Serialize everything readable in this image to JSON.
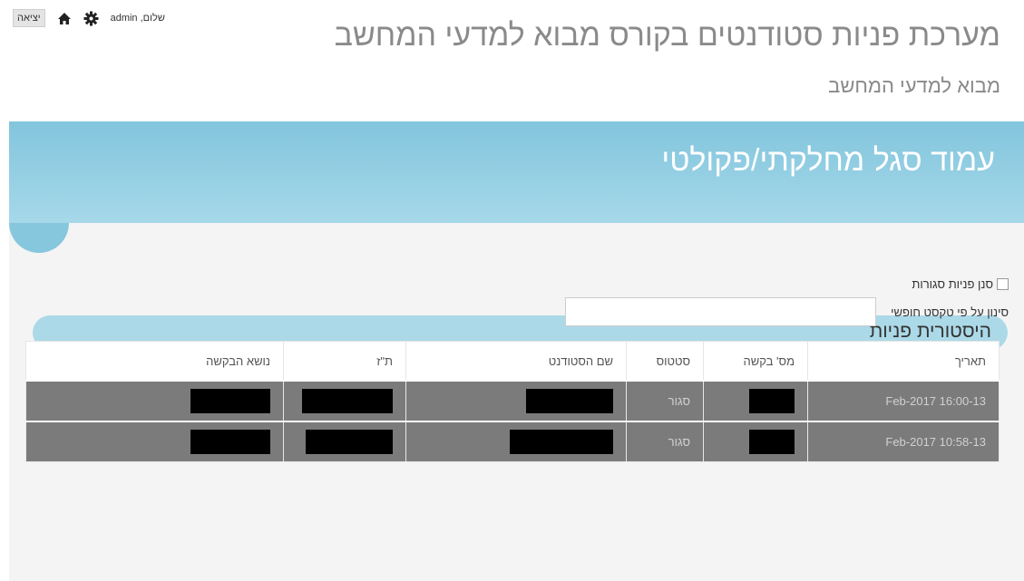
{
  "topbar": {
    "logout_label": "יציאה",
    "home_icon": "home-icon",
    "settings_icon": "gear-icon",
    "greeting": "שלום, admin"
  },
  "header": {
    "title": "מערכת פניות סטודנטים בקורס מבוא למדעי המחשב",
    "subtitle": "מבוא למדעי המחשב"
  },
  "banner": {
    "title": "עמוד סגל מחלקתי/פקולטי"
  },
  "section": {
    "title": "היסטורית פניות"
  },
  "filters": {
    "closed_label": "סנן פניות סגורות",
    "freetext_label": "סינון על פי טקסט חופשי",
    "freetext_value": ""
  },
  "table": {
    "headers": [
      "תאריך",
      "מס' בקשה",
      "סטטוס",
      "שם הסטודנט",
      "ת\"ז",
      "נושא הבקשה"
    ],
    "rows": [
      {
        "date": "13-Feb-2017 16:00",
        "status": "סגור"
      },
      {
        "date": "13-Feb-2017 10:58",
        "status": "סגור"
      }
    ]
  },
  "colors": {
    "banner": "#8ccbe0",
    "section_bar": "#acd9e8",
    "row_bg": "#7b7b7b",
    "title_text": "#8a8a8a"
  }
}
